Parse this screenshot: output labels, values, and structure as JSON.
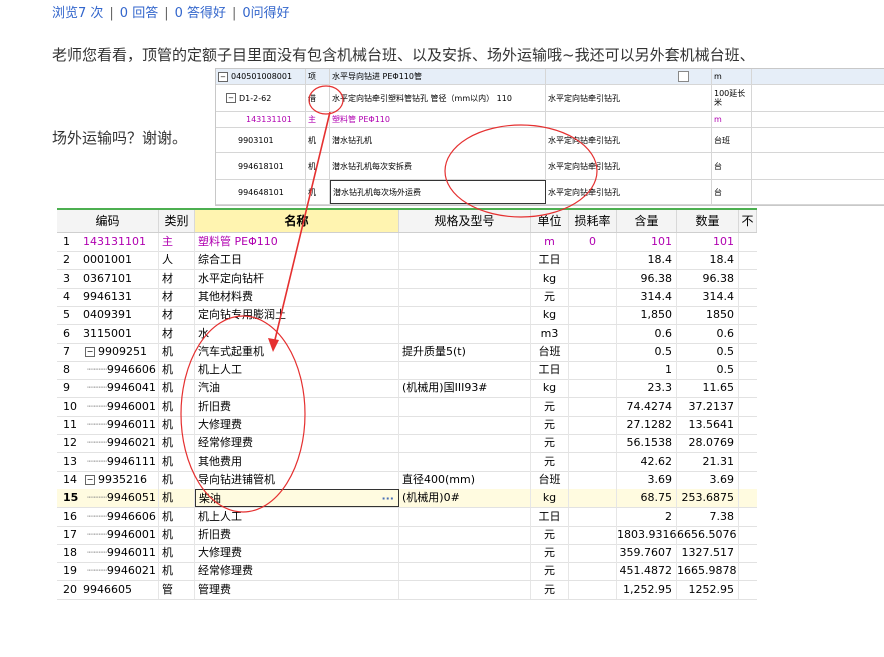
{
  "stats": {
    "views": "浏览7 次",
    "answers": "0 回答",
    "good_answers": "0 答得好",
    "good_questions": "0问得好"
  },
  "question": {
    "line1": "老师您看看，顶管的定额子目里面没有包含机械台班、以及安拆、场外运输哦~我还可以另外套机械台班、",
    "line2": "场外运输吗？谢谢。"
  },
  "upper_table": {
    "rows": [
      {
        "code": "040501008001",
        "type": "项",
        "name": "水平导向钻进 PEΦ110管",
        "spec": "",
        "unit": "m"
      },
      {
        "code": "D1-2-62",
        "type": "借",
        "name": "水平定向钻牵引塑料管钻孔 管径（mm以内） 110",
        "spec": "水平定向钻牵引钻孔",
        "unit": "100延长米"
      },
      {
        "code": "143131101",
        "type": "主",
        "name": "塑料管 PEΦ110",
        "spec": "",
        "unit": "m"
      },
      {
        "code": "9903101",
        "type": "机",
        "name": "潜水钻孔机",
        "spec": "水平定向钻牵引钻孔",
        "unit": "台班"
      },
      {
        "code": "994618101",
        "type": "机",
        "name": "潜水钻孔机每次安拆费",
        "spec": "水平定向钻牵引钻孔",
        "unit": "台"
      },
      {
        "code": "994648101",
        "type": "机",
        "name": "潜水钻孔机每次场外运费",
        "spec": "水平定向钻牵引钻孔",
        "unit": "台"
      }
    ]
  },
  "table": {
    "headers": [
      "编码",
      "类别",
      "名称",
      "规格及型号",
      "单位",
      "损耗率",
      "含量",
      "数量",
      "不"
    ],
    "rows": [
      {
        "no": "1",
        "code": "143131101",
        "type": "主",
        "name": "塑料管 PEΦ110",
        "spec": "",
        "unit": "m",
        "loss": "0",
        "content": "101",
        "qty": "101"
      },
      {
        "no": "2",
        "code": "0001001",
        "type": "人",
        "name": "综合工日",
        "spec": "",
        "unit": "工日",
        "loss": "",
        "content": "18.4",
        "qty": "18.4"
      },
      {
        "no": "3",
        "code": "0367101",
        "type": "材",
        "name": "水平定向钻杆",
        "spec": "",
        "unit": "kg",
        "loss": "",
        "content": "96.38",
        "qty": "96.38"
      },
      {
        "no": "4",
        "code": "9946131",
        "type": "材",
        "name": "其他材料费",
        "spec": "",
        "unit": "元",
        "loss": "",
        "content": "314.4",
        "qty": "314.4"
      },
      {
        "no": "5",
        "code": "0409391",
        "type": "材",
        "name": "定向钻专用膨润土",
        "spec": "",
        "unit": "kg",
        "loss": "",
        "content": "1,850",
        "qty": "1850"
      },
      {
        "no": "6",
        "code": "3115001",
        "type": "材",
        "name": "水",
        "spec": "",
        "unit": "m3",
        "loss": "",
        "content": "0.6",
        "qty": "0.6"
      },
      {
        "no": "7",
        "code": "9909251",
        "type": "机",
        "name": "汽车式起重机",
        "spec": "提升质量5(t)",
        "unit": "台班",
        "loss": "",
        "content": "0.5",
        "qty": "0.5"
      },
      {
        "no": "8",
        "code": "9946606",
        "type": "机",
        "name": "机上人工",
        "spec": "",
        "unit": "工日",
        "loss": "",
        "content": "1",
        "qty": "0.5"
      },
      {
        "no": "9",
        "code": "9946041",
        "type": "机",
        "name": "汽油",
        "spec": "(机械用)国III93#",
        "unit": "kg",
        "loss": "",
        "content": "23.3",
        "qty": "11.65"
      },
      {
        "no": "10",
        "code": "9946001",
        "type": "机",
        "name": "折旧费",
        "spec": "",
        "unit": "元",
        "loss": "",
        "content": "74.4274",
        "qty": "37.2137"
      },
      {
        "no": "11",
        "code": "9946011",
        "type": "机",
        "name": "大修理费",
        "spec": "",
        "unit": "元",
        "loss": "",
        "content": "27.1282",
        "qty": "13.5641"
      },
      {
        "no": "12",
        "code": "9946021",
        "type": "机",
        "name": "经常修理费",
        "spec": "",
        "unit": "元",
        "loss": "",
        "content": "56.1538",
        "qty": "28.0769"
      },
      {
        "no": "13",
        "code": "9946111",
        "type": "机",
        "name": "其他费用",
        "spec": "",
        "unit": "元",
        "loss": "",
        "content": "42.62",
        "qty": "21.31"
      },
      {
        "no": "14",
        "code": "9935216",
        "type": "机",
        "name": "导向钻进铺管机",
        "spec": "直径400(mm)",
        "unit": "台班",
        "loss": "",
        "content": "3.69",
        "qty": "3.69"
      },
      {
        "no": "15",
        "code": "9946051",
        "type": "机",
        "name": "柴油",
        "spec": "(机械用)0#",
        "unit": "kg",
        "loss": "",
        "content": "68.75",
        "qty": "253.6875"
      },
      {
        "no": "16",
        "code": "9946606",
        "type": "机",
        "name": "机上人工",
        "spec": "",
        "unit": "工日",
        "loss": "",
        "content": "2",
        "qty": "7.38"
      },
      {
        "no": "17",
        "code": "9946001",
        "type": "机",
        "name": "折旧费",
        "spec": "",
        "unit": "元",
        "loss": "",
        "content": "1803.9316",
        "qty": "6656.5076"
      },
      {
        "no": "18",
        "code": "9946011",
        "type": "机",
        "name": "大修理费",
        "spec": "",
        "unit": "元",
        "loss": "",
        "content": "359.7607",
        "qty": "1327.517"
      },
      {
        "no": "19",
        "code": "9946021",
        "type": "机",
        "name": "经常修理费",
        "spec": "",
        "unit": "元",
        "loss": "",
        "content": "451.4872",
        "qty": "1665.9878"
      },
      {
        "no": "20",
        "code": "9946605",
        "type": "管",
        "name": "管理费",
        "spec": "",
        "unit": "元",
        "loss": "",
        "content": "1,252.95",
        "qty": "1252.95"
      }
    ]
  },
  "colors": {
    "accent": "#3366cc",
    "annotation": "#e53030",
    "main_material": "#b000b0",
    "header_highlight": "#fff4b0"
  }
}
